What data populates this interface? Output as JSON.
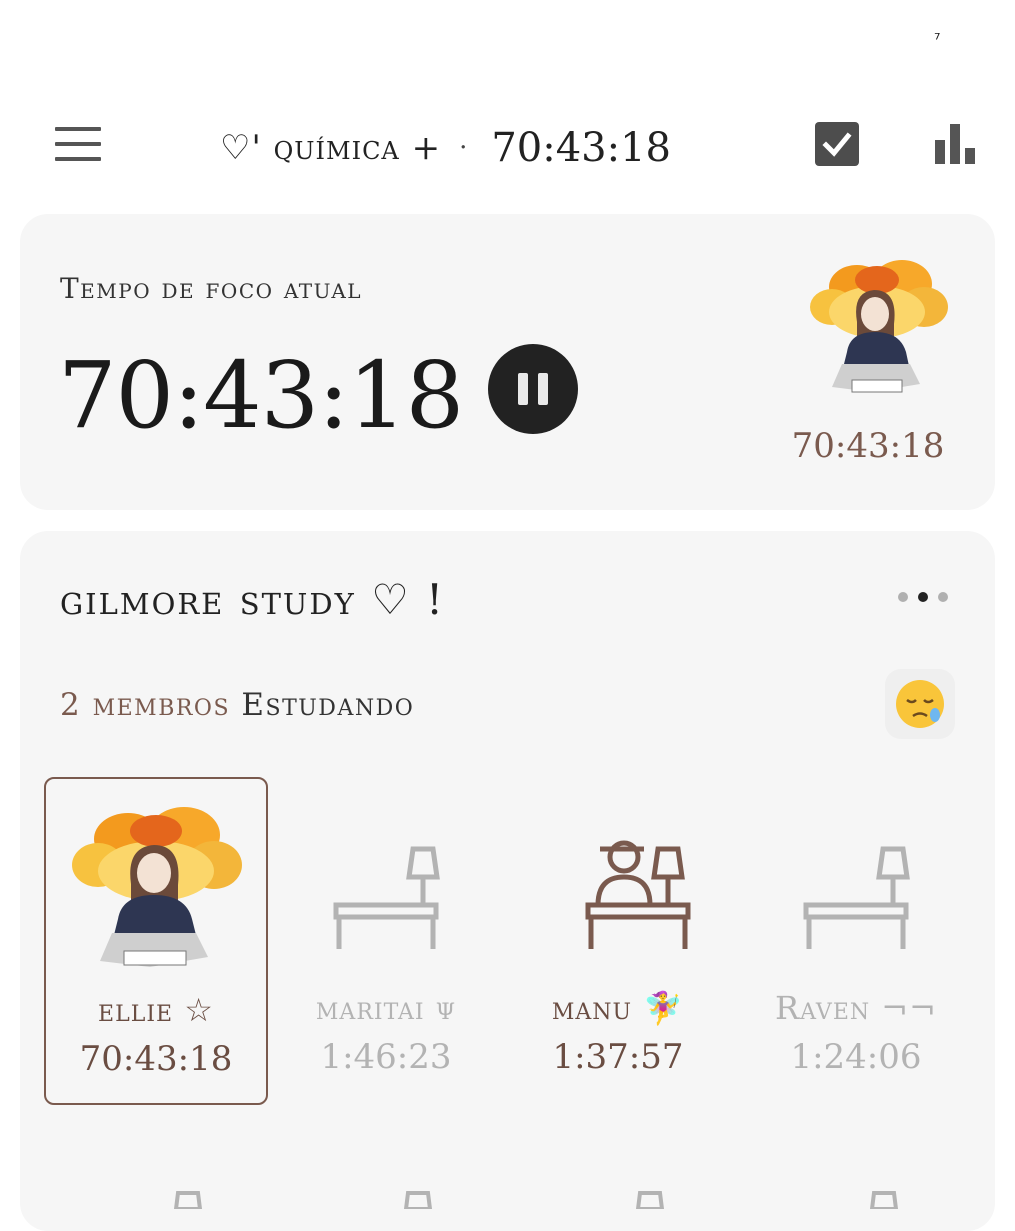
{
  "status": {
    "glyph": "⁷"
  },
  "header": {
    "menu_icon": "hamburger-icon",
    "subject": "♡' química +",
    "separator": "·",
    "timer": "70:43:18",
    "check_icon": "checkbox-checked-icon",
    "stats_icon": "bar-chart-icon"
  },
  "focus": {
    "label": "Tempo de foco atual",
    "time": "70:43:18",
    "pause_icon": "pause-icon",
    "avatar_time": "70:43:18"
  },
  "group": {
    "name": "gilmore study ♡ !",
    "more_icon": "more-dots-icon",
    "members_count": "2 membros",
    "members_verb": "Estudando",
    "status_emoji": "😪",
    "members": [
      {
        "name": "ellie ☆",
        "time": "70:43:18",
        "state": "studying-avatar"
      },
      {
        "name": "maritai ψ",
        "time": "1:46:23",
        "state": "away"
      },
      {
        "name": "manu 🧚‍♀️",
        "time": "1:37:57",
        "state": "studying"
      },
      {
        "name": "Raven ¬¬",
        "time": "1:24:06",
        "state": "away"
      }
    ]
  },
  "colors": {
    "accent_brown": "#7a5a4e",
    "card_bg": "#f6f6f6",
    "faded_gray": "#b3b3b3",
    "avatar_orange": "#f39a1e"
  }
}
